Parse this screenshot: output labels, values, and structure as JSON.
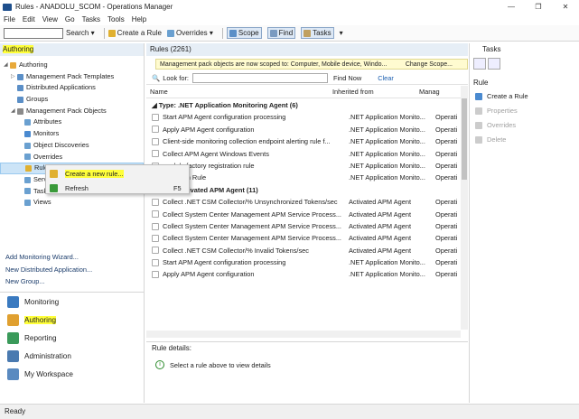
{
  "window": {
    "title": "Rules - ANADOLU_SCOM - Operations Manager",
    "minimize": "—",
    "restore": "❐",
    "close": "✕"
  },
  "menu": [
    "File",
    "Edit",
    "View",
    "Go",
    "Tasks",
    "Tools",
    "Help"
  ],
  "toolbar": {
    "search_label": "Search",
    "create_rule": "Create a Rule",
    "overrides": "Overrides",
    "scope": "Scope",
    "find": "Find",
    "tasks": "Tasks"
  },
  "nav": {
    "header": "Authoring",
    "tree": [
      {
        "label": "Authoring",
        "indent": 0,
        "twisty": "◢",
        "icon": "#e8a93a"
      },
      {
        "label": "Management Pack Templates",
        "indent": 1,
        "twisty": "▷",
        "icon": "#5b8fc7"
      },
      {
        "label": "Distributed Applications",
        "indent": 1,
        "twisty": "",
        "icon": "#5b8fc7"
      },
      {
        "label": "Groups",
        "indent": 1,
        "twisty": "",
        "icon": "#5b8fc7"
      },
      {
        "label": "Management Pack Objects",
        "indent": 1,
        "twisty": "◢",
        "icon": "#8a8a8a"
      },
      {
        "label": "Attributes",
        "indent": 2,
        "twisty": "",
        "icon": "#6aa0d0"
      },
      {
        "label": "Monitors",
        "indent": 2,
        "twisty": "",
        "icon": "#4a8ad0"
      },
      {
        "label": "Object Discoveries",
        "indent": 2,
        "twisty": "",
        "icon": "#6aa0d0"
      },
      {
        "label": "Overrides",
        "indent": 2,
        "twisty": "",
        "icon": "#6aa0d0"
      },
      {
        "label": "Rules",
        "indent": 2,
        "twisty": "",
        "icon": "#e0b030",
        "selected": true
      },
      {
        "label": "Servi",
        "indent": 2,
        "twisty": "",
        "icon": "#6aa0d0"
      },
      {
        "label": "Tasks",
        "indent": 2,
        "twisty": "",
        "icon": "#6aa0d0"
      },
      {
        "label": "Views",
        "indent": 2,
        "twisty": "",
        "icon": "#6aa0d0"
      }
    ],
    "links": [
      "Add Monitoring Wizard...",
      "New Distributed Application...",
      "New Group..."
    ],
    "wunderbar": [
      {
        "label": "Monitoring",
        "icon": "#3a7ac0"
      },
      {
        "label": "Authoring",
        "icon": "#e0a030",
        "active": true
      },
      {
        "label": "Reporting",
        "icon": "#3a9a5a"
      },
      {
        "label": "Administration",
        "icon": "#4a7ab0"
      },
      {
        "label": "My Workspace",
        "icon": "#5a8ac0"
      }
    ]
  },
  "context_menu": [
    {
      "label": "Create a new rule...",
      "shortcut": "",
      "highlighted": true
    },
    {
      "label": "Refresh",
      "shortcut": "F5"
    }
  ],
  "center": {
    "title": "Rules (2261)",
    "notice": "Management pack objects are now scoped to: Computer, Mobile device, Windo...",
    "change_scope": "Change Scope...",
    "look_for": "Look for:",
    "find_now": "Find Now",
    "clear": "Clear",
    "columns": [
      "Name",
      "Inherited from",
      "Manag"
    ],
    "groups": [
      {
        "label": "Type: .NET Application Monitoring Agent (6)",
        "rows": [
          {
            "name": "Start APM Agent configuration processing",
            "inherited": ".NET Application Monito...",
            "mp": "Operati"
          },
          {
            "name": "Apply APM Agent configuration",
            "inherited": ".NET Application Monito...",
            "mp": "Operati"
          },
          {
            "name": "Client-side monitoring collection endpoint alerting rule f...",
            "inherited": ".NET Application Monito...",
            "mp": "Operati"
          },
          {
            "name": "Collect APM Agent Windows Events",
            "inherited": ".NET Application Monito...",
            "mp": "Operati"
          },
          {
            "name": "module factory registration rule",
            "inherited": ".NET Application Monito...",
            "mp": "Operati"
          },
          {
            "name": "collection Rule",
            "inherited": ".NET Application Monito...",
            "mp": "Operati"
          }
        ]
      },
      {
        "label": "Type: Activated APM Agent (11)",
        "rows": [
          {
            "name": "Collect .NET CSM Collector/% Unsynchronized Tokens/sec",
            "inherited": "Activated APM Agent",
            "mp": "Operati"
          },
          {
            "name": "Collect System Center Management APM Service Process...",
            "inherited": "Activated APM Agent",
            "mp": "Operati"
          },
          {
            "name": "Collect System Center Management APM Service Process...",
            "inherited": "Activated APM Agent",
            "mp": "Operati"
          },
          {
            "name": "Collect System Center Management APM Service Process...",
            "inherited": "Activated APM Agent",
            "mp": "Operati"
          },
          {
            "name": "Collect .NET CSM Collector/% Invalid Tokens/sec",
            "inherited": "Activated APM Agent",
            "mp": "Operati"
          },
          {
            "name": "Start APM Agent configuration processing",
            "inherited": ".NET Application Monito...",
            "mp": "Operati"
          },
          {
            "name": "Apply APM Agent configuration",
            "inherited": ".NET Application Monito...",
            "mp": "Operati"
          }
        ]
      }
    ],
    "details_title": "Rule details:",
    "details_message": "Select a rule above to view details"
  },
  "tasks_pane": {
    "header": "Tasks",
    "section": "Rule",
    "items": [
      {
        "label": "Create a Rule",
        "enabled": true,
        "icon": "#4a8ad0"
      },
      {
        "label": "Properties",
        "enabled": false,
        "icon": "#cccccc"
      },
      {
        "label": "Overrides",
        "enabled": false,
        "icon": "#cccccc"
      },
      {
        "label": "Delete",
        "enabled": false,
        "icon": "#cccccc"
      }
    ]
  },
  "status": "Ready"
}
